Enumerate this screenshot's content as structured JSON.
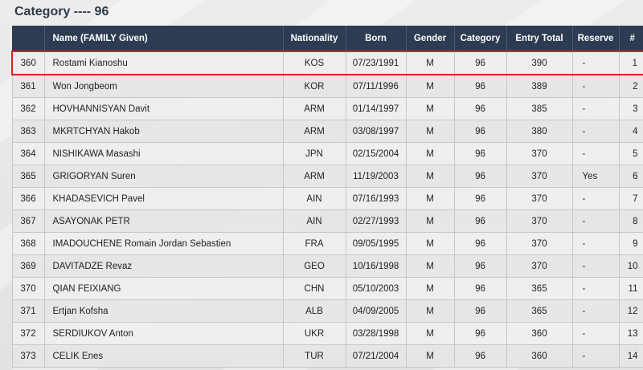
{
  "page": {
    "title": "Category ---- 96"
  },
  "table": {
    "columns": [
      "",
      "Name (FAMILY Given)",
      "Nationality",
      "Born",
      "Gender",
      "Category",
      "Entry Total",
      "Reserve",
      "#"
    ],
    "highlight_color": "#dd2222",
    "rows": [
      {
        "id": "360",
        "name": "Rostami Kianoshu",
        "nat": "KOS",
        "born": "07/23/1991",
        "gender": "M",
        "cat": "96",
        "total": "390",
        "reserve": "-",
        "num": "1"
      },
      {
        "id": "361",
        "name": "Won Jongbeom",
        "nat": "KOR",
        "born": "07/11/1996",
        "gender": "M",
        "cat": "96",
        "total": "389",
        "reserve": "-",
        "num": "2"
      },
      {
        "id": "362",
        "name": "HOVHANNISYAN Davit",
        "nat": "ARM",
        "born": "01/14/1997",
        "gender": "M",
        "cat": "96",
        "total": "385",
        "reserve": "-",
        "num": "3"
      },
      {
        "id": "363",
        "name": "MKRTCHYAN Hakob",
        "nat": "ARM",
        "born": "03/08/1997",
        "gender": "M",
        "cat": "96",
        "total": "380",
        "reserve": "-",
        "num": "4"
      },
      {
        "id": "364",
        "name": "NISHIKAWA Masashi",
        "nat": "JPN",
        "born": "02/15/2004",
        "gender": "M",
        "cat": "96",
        "total": "370",
        "reserve": "-",
        "num": "5"
      },
      {
        "id": "365",
        "name": "GRIGORYAN Suren",
        "nat": "ARM",
        "born": "11/19/2003",
        "gender": "M",
        "cat": "96",
        "total": "370",
        "reserve": "Yes",
        "num": "6"
      },
      {
        "id": "366",
        "name": "KHADASEVICH Pavel",
        "nat": "AIN",
        "born": "07/16/1993",
        "gender": "M",
        "cat": "96",
        "total": "370",
        "reserve": "-",
        "num": "7"
      },
      {
        "id": "367",
        "name": "ASAYONAK PETR",
        "nat": "AIN",
        "born": "02/27/1993",
        "gender": "M",
        "cat": "96",
        "total": "370",
        "reserve": "-",
        "num": "8"
      },
      {
        "id": "368",
        "name": "IMADOUCHENE Romain Jordan Sebastien",
        "nat": "FRA",
        "born": "09/05/1995",
        "gender": "M",
        "cat": "96",
        "total": "370",
        "reserve": "-",
        "num": "9"
      },
      {
        "id": "369",
        "name": "DAVITADZE Revaz",
        "nat": "GEO",
        "born": "10/16/1998",
        "gender": "M",
        "cat": "96",
        "total": "370",
        "reserve": "-",
        "num": "10"
      },
      {
        "id": "370",
        "name": "QIAN FEIXIANG",
        "nat": "CHN",
        "born": "05/10/2003",
        "gender": "M",
        "cat": "96",
        "total": "365",
        "reserve": "-",
        "num": "11"
      },
      {
        "id": "371",
        "name": "Ertjan Kofsha",
        "nat": "ALB",
        "born": "04/09/2005",
        "gender": "M",
        "cat": "96",
        "total": "365",
        "reserve": "-",
        "num": "12"
      },
      {
        "id": "372",
        "name": "SERDIUKOV Anton",
        "nat": "UKR",
        "born": "03/28/1998",
        "gender": "M",
        "cat": "96",
        "total": "360",
        "reserve": "-",
        "num": "13"
      },
      {
        "id": "373",
        "name": "CELIK Enes",
        "nat": "TUR",
        "born": "07/21/2004",
        "gender": "M",
        "cat": "96",
        "total": "360",
        "reserve": "-",
        "num": "14"
      }
    ]
  }
}
